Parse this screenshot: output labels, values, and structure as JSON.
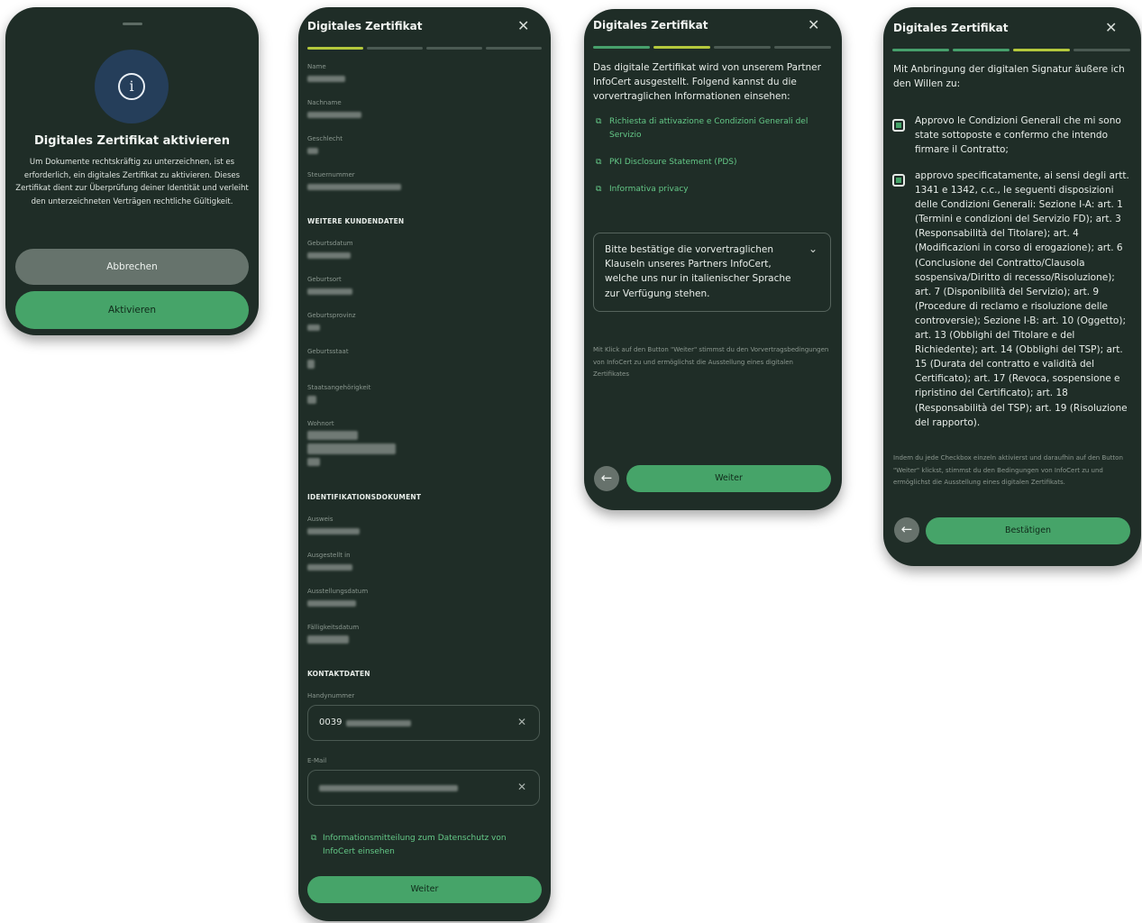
{
  "panel1": {
    "title": "Digitales Zertifikat aktivieren",
    "body": "Um Dokumente rechtskräftig zu unterzeichnen, ist es erforderlich, ein digitales Zertifikat zu aktivieren. Dieses Zertifikat dient zur Überprüfung deiner Identität und verleiht den unterzeichneten Verträgen rechtliche Gültigkeit.",
    "cancel_label": "Abbrechen",
    "activate_label": "Aktivieren",
    "icon": "info-icon",
    "info_glyph": "i"
  },
  "panel2": {
    "title": "Digitales Zertifikat",
    "fields": [
      "Name",
      "Nachname",
      "Geschlecht",
      "Steuernummer"
    ],
    "section_customer": "WEITERE KUNDENDATEN",
    "customer_fields": [
      "Geburtsdatum",
      "Geburtsort",
      "Geburtsprovinz",
      "Geburtsstaat",
      "Staatsangehörigkeit",
      "Wohnort"
    ],
    "section_id": "IDENTIFIKATIONSDOKUMENT",
    "id_fields": [
      "Ausweis",
      "Ausgestellt in",
      "Ausstellungsdatum",
      "Fälligkeitsdatum"
    ],
    "section_contact": "KONTAKTDATEN",
    "phone_label": "Handynummer",
    "phone_value": "0039",
    "email_label": "E-Mail",
    "privacy_link": "Informationsmitteilung zum Datenschutz von InfoCert einsehen",
    "next_label": "Weiter"
  },
  "panel3": {
    "title": "Digitales Zertifikat",
    "intro": "Das digitale Zertifikat wird von unserem Partner InfoCert ausgestellt. Folgend kannst du die vorvertraglichen Informationen einsehen:",
    "links": [
      "Richiesta di attivazione e Condizioni Generali del Servizio",
      "PKI Disclosure Statement (PDS)",
      "Informativa privacy"
    ],
    "accordion_text": "Bitte bestätige die vorvertraglichen Klauseln unseres Partners InfoCert, welche uns nur in italienischer Sprache zur Verfügung stehen.",
    "note": "Mit Klick auf den Button \"Weiter\" stimmst du den Vorvertragsbedingungen von InfoCert zu und ermöglichst die Ausstellung eines digitalen Zertifikates",
    "next_label": "Weiter"
  },
  "panel4": {
    "title": "Digitales Zertifikat",
    "intro": "Mit Anbringung der digitalen Signatur äußere ich den Willen zu:",
    "checkbox1": "Approvo le Condizioni Generali che mi sono state sottoposte e confermo che intendo firmare il Contratto;",
    "checkbox2": "approvo specificatamente, ai sensi degli artt. 1341 e 1342, c.c., le seguenti disposizioni delle Condizioni Generali: Sezione I-A: art. 1 (Termini e condizioni del Servizio FD); art. 3 (Responsabilità del Titolare); art. 4 (Modificazioni in corso di erogazione); art. 6 (Conclusione del Contratto/Clausola sospensiva/Diritto di recesso/Risoluzione); art. 7 (Disponibilità del Servizio); art. 9 (Procedure di reclamo e risoluzione delle controversie); Sezione I-B: art. 10 (Oggetto); art. 13 (Obblighi del Titolare e del Richiedente); art. 14 (Obblighi del TSP); art. 15 (Durata del contratto e validità del Certificato); art. 17 (Revoca, sospensione e ripristino del Certificato); art. 18 (Responsabilità del TSP); art. 19 (Risoluzione del rapporto).",
    "note": "Indem du jede Checkbox einzeln aktivierst und daraufhin auf den Button \"Weiter\" klickst, stimmst du den Bedingungen von InfoCert zu und ermöglichst die Ausstellung eines digitalen Zertifikats.",
    "confirm_label": "Bestätigen"
  },
  "colors": {
    "background": "#1f2d27",
    "accent": "#46a469",
    "link": "#64c887",
    "step_active": "#b4c83c"
  }
}
